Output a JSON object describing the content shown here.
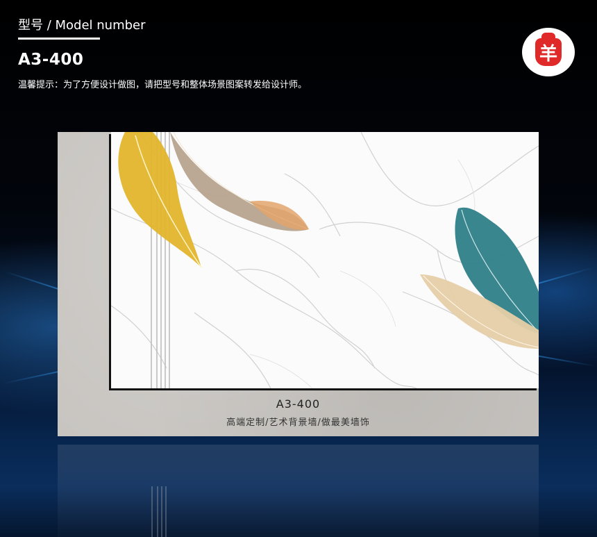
{
  "header": {
    "title": "型号 / Model number",
    "model": "A3-400",
    "notice": "温馨提示：为了方便设计做图，请把型号和整体场景图案转发给设计师。"
  },
  "logo": {
    "glyph": "羊",
    "brand_color": "#e02a2a"
  },
  "caption": {
    "model": "A3-400",
    "subtitle": "高端定制/艺术背景墙/做最美墙饰"
  },
  "colors": {
    "background": "#000000",
    "panel": "#c8c5c1",
    "artwork_bg": "#fbfbfb",
    "feather_gold": "#e2b52c",
    "feather_taupe": "#b4a08a",
    "feather_teal": "#2f7f88",
    "feather_beige": "#e6cfa8"
  }
}
